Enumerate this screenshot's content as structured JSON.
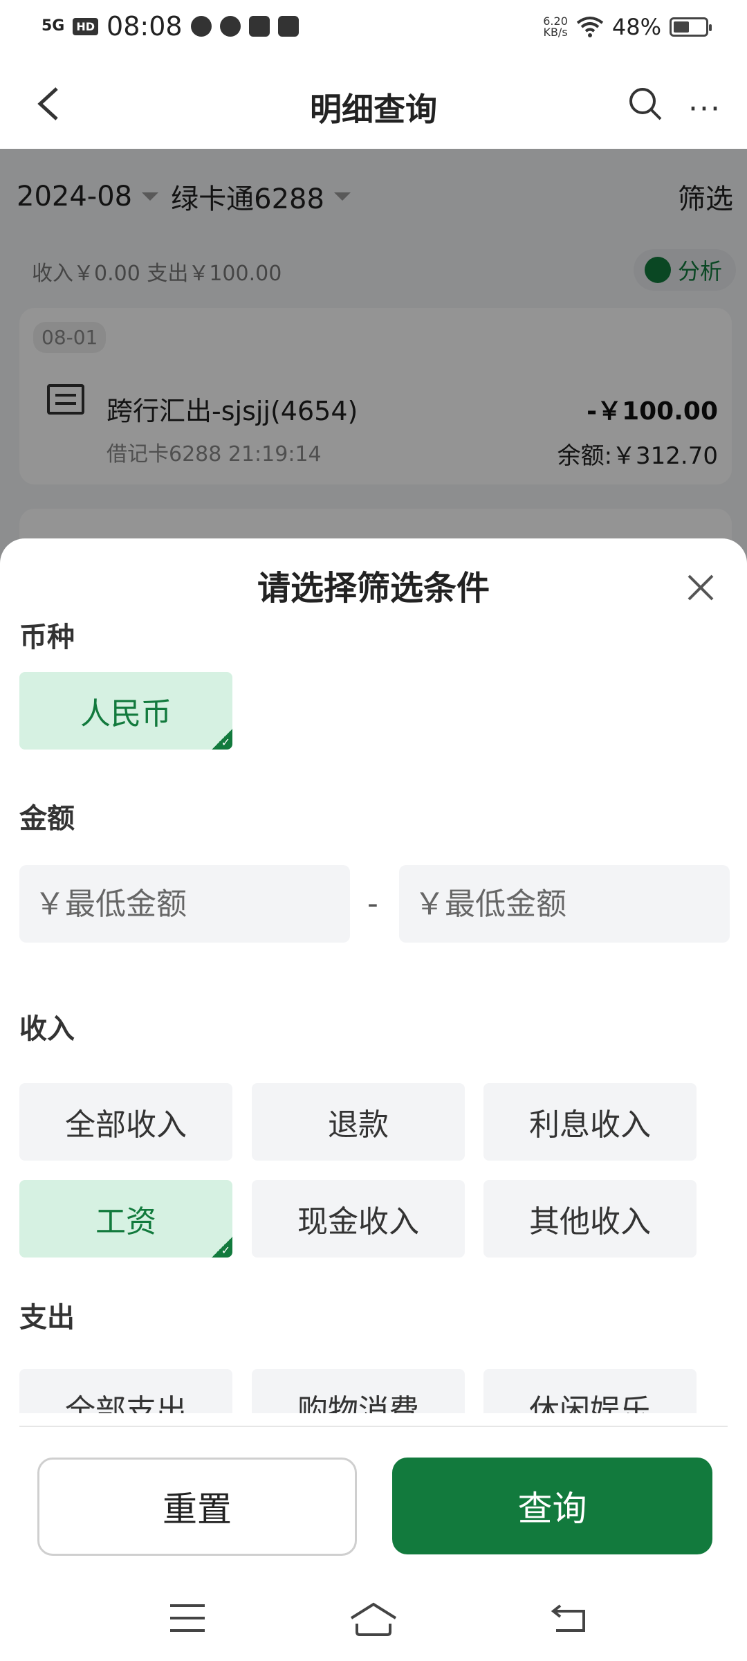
{
  "status_bar": {
    "network": "5G",
    "hd": "HD",
    "time": "08:08",
    "speed_value": "6.20",
    "speed_unit": "KB/s",
    "battery": "48%"
  },
  "header": {
    "back_icon": "chevron-left-icon",
    "title": "明细查询",
    "search_icon": "search-icon",
    "more_icon": "more-icon"
  },
  "background": {
    "month": "2024-08",
    "card": "绿卡通6288",
    "filter": "筛选",
    "summary": "收入￥0.00 支出￥100.00",
    "analyse": "分析",
    "transaction": {
      "date": "08-01",
      "title": "跨行汇出-sjsjj(4654)",
      "amount": "-￥100.00",
      "sub": "借记卡6288  21:19:14",
      "balance": "余额:￥312.70"
    }
  },
  "sheet": {
    "title": "请选择筛选条件",
    "close_icon": "close-icon",
    "currency": {
      "label": "币种",
      "options": [
        {
          "label": "人民币",
          "selected": true
        }
      ]
    },
    "amount": {
      "label": "金额",
      "min_placeholder": "￥最低金额",
      "max_placeholder": "￥最低金额",
      "dash": "-"
    },
    "income": {
      "label": "收入",
      "options": [
        {
          "label": "全部收入",
          "selected": false
        },
        {
          "label": "退款",
          "selected": false
        },
        {
          "label": "利息收入",
          "selected": false
        },
        {
          "label": "工资",
          "selected": true
        },
        {
          "label": "现金收入",
          "selected": false
        },
        {
          "label": "其他收入",
          "selected": false
        }
      ]
    },
    "expense": {
      "label": "支出",
      "options": [
        {
          "label": "全部支出",
          "selected": false
        },
        {
          "label": "购物消费",
          "selected": false
        },
        {
          "label": "休闲娱乐",
          "selected": false
        }
      ]
    },
    "reset_label": "重置",
    "query_label": "查询"
  },
  "colors": {
    "accent": "#127a3d",
    "selected_bg": "#d6f1e2",
    "chip_bg": "#f3f4f6"
  }
}
